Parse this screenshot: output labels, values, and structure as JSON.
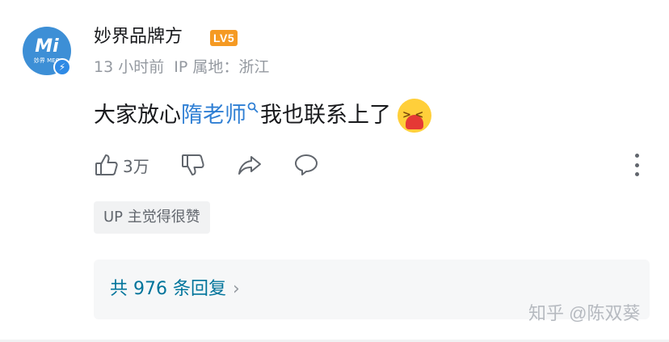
{
  "comment": {
    "avatar": {
      "mark": "Mi",
      "sub": "妙界 MEO"
    },
    "username": "妙界品牌方",
    "level_badge": "LV5",
    "time": "13 小时前",
    "ip_location": "IP 属地：浙江",
    "text_before": "大家放心",
    "link_text": "隋老师",
    "text_after": "我也联系上了",
    "like_count": "3万",
    "tag": "UP 主觉得很赞",
    "replies_label": "共 976 条回复"
  },
  "watermark": "知乎 @陈双葵",
  "colors": {
    "link": "#2f7fd4",
    "level_badge": "#f59a23",
    "replies": "#00749b",
    "meta": "#9499a0"
  },
  "icons": {
    "verified": "lightning-icon",
    "like": "thumbs-up-icon",
    "dislike": "thumbs-down-icon",
    "share": "share-arrow-icon",
    "reply": "speech-bubble-icon",
    "more": "more-vertical-icon",
    "emoji": "hugging-heart-emoji"
  }
}
